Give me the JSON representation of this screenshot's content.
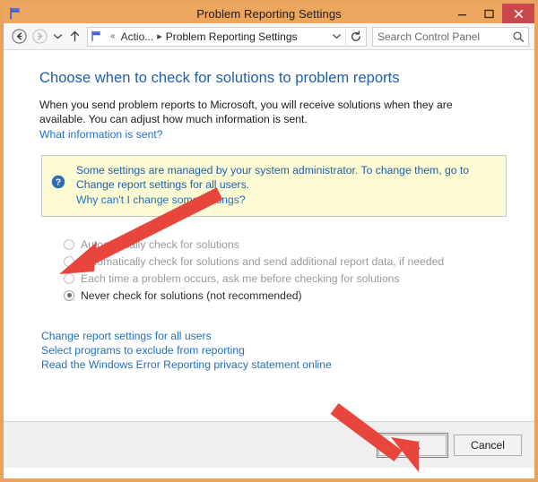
{
  "window": {
    "title": "Problem Reporting Settings",
    "icon": "flag-icon",
    "controls": {
      "minimize": "minimize-icon",
      "maximize": "maximize-icon",
      "close": "close-icon"
    }
  },
  "toolbar": {
    "back": "back-arrow-icon",
    "forward": "forward-arrow-icon",
    "recent_dropdown": "chevron-down-icon",
    "up": "up-arrow-icon",
    "address": {
      "icon": "flag-icon",
      "separator_chevrons": "«",
      "crumb_truncated": "Actio...",
      "crumb_arrow": "▸",
      "crumb_current": "Problem Reporting Settings",
      "dropdown": "chevron-down-icon",
      "refresh": "refresh-icon"
    },
    "search": {
      "placeholder": "Search Control Panel",
      "value": "",
      "icon": "search-icon"
    }
  },
  "content": {
    "page_title": "Choose when to check for solutions to problem reports",
    "intro": "When you send problem reports to Microsoft, you will receive solutions when they are available. You can adjust how much information is sent.",
    "what_info_link": "What information is sent?",
    "notice": {
      "icon": "help-circle-icon",
      "text": "Some settings are managed by your system administrator. To change them, go to Change report settings for all users.",
      "link": "Why can't I change some settings?"
    },
    "options": [
      {
        "label": "Automatically check for solutions",
        "selected": false,
        "disabled": true
      },
      {
        "label": "Automatically check for solutions and send additional report data, if needed",
        "selected": false,
        "disabled": true
      },
      {
        "label": "Each time a problem occurs, ask me before checking for solutions",
        "selected": false,
        "disabled": true
      },
      {
        "label": "Never check for solutions (not recommended)",
        "selected": true,
        "disabled": false
      }
    ],
    "links": [
      "Change report settings for all users",
      "Select programs to exclude from reporting",
      "Read the Windows Error Reporting privacy statement online"
    ]
  },
  "footer": {
    "ok_label": "OK",
    "cancel_label": "Cancel"
  },
  "annotations": {
    "arrow_color": "#E8453C",
    "arrow_1_target": "never-check-radio",
    "arrow_2_target": "ok-button"
  },
  "colors": {
    "titlebar": "#ECA65E",
    "close_button": "#C9484B",
    "heading_blue": "#1F5FA8",
    "link_blue": "#1F6FC4",
    "notice_background": "#FCFBD4",
    "footer_background": "#EFEFEF"
  }
}
